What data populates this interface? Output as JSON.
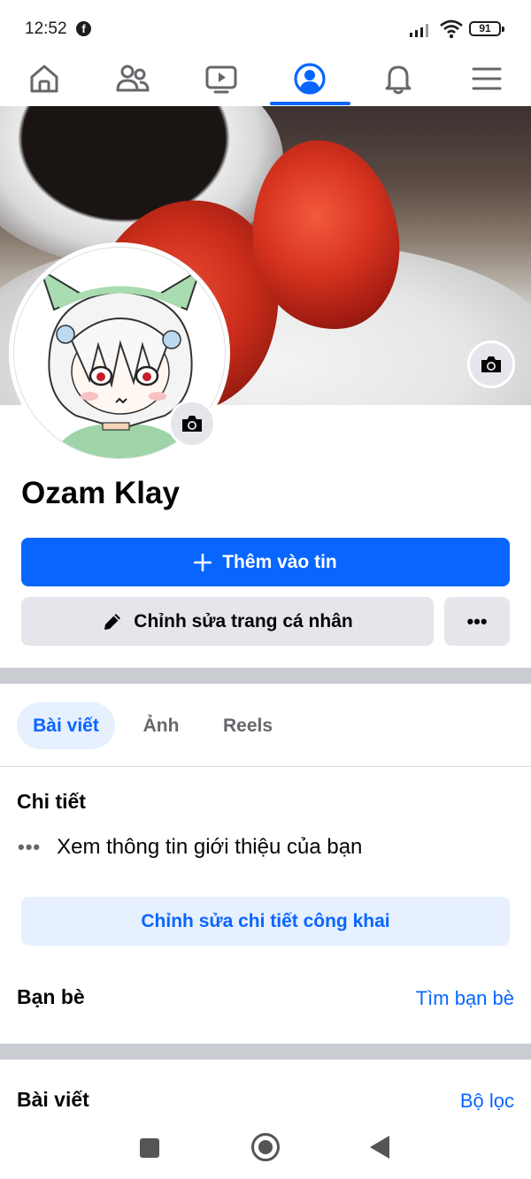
{
  "status_bar": {
    "time": "12:52",
    "notification_icon": "facebook-icon",
    "battery_level": "91",
    "signal_icon": "cell-signal-icon",
    "wifi_icon": "wifi-icon"
  },
  "top_nav": {
    "items": [
      {
        "name": "home",
        "icon": "home-icon",
        "active": false
      },
      {
        "name": "friends",
        "icon": "friends-icon",
        "active": false
      },
      {
        "name": "video",
        "icon": "video-icon",
        "active": false
      },
      {
        "name": "profile",
        "icon": "profile-icon",
        "active": true
      },
      {
        "name": "notifications",
        "icon": "bell-icon",
        "active": false
      },
      {
        "name": "menu",
        "icon": "menu-icon",
        "active": false
      }
    ],
    "accent_color": "#0866ff"
  },
  "profile": {
    "name": "Ozam Klay",
    "cover_camera_icon": "camera-icon",
    "avatar_camera_icon": "camera-icon"
  },
  "actions": {
    "add_story_label": "Thêm vào tin",
    "edit_profile_label": "Chỉnh sửa trang cá nhân",
    "more_label": "•••"
  },
  "tabs": {
    "items": [
      "Bài viết",
      "Ảnh",
      "Reels"
    ],
    "active_index": 0
  },
  "details": {
    "title": "Chi tiết",
    "intro_text": "Xem thông tin giới thiệu của bạn",
    "intro_dots": "•••",
    "edit_public_label": "Chỉnh sửa chi tiết công khai"
  },
  "friends": {
    "title": "Bạn bè",
    "find_link": "Tìm bạn bè"
  },
  "posts": {
    "title": "Bài viết",
    "filter_link": "Bộ lọc"
  },
  "colors": {
    "brand_blue": "#0866ff",
    "light_blue_bg": "#e7f0ff",
    "gray_button": "#e4e6eb",
    "divider": "#c9ccd1"
  }
}
